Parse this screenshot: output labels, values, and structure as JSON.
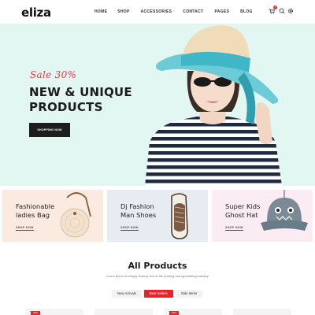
{
  "header": {
    "logo": "eliza",
    "nav": [
      "HOME",
      "SHOP",
      "ACCESSORIES",
      "CONTACT",
      "PAGES",
      "BLOG"
    ],
    "cart_count": "0",
    "icons": [
      "cart-icon",
      "search-icon",
      "settings-icon"
    ]
  },
  "hero": {
    "sale_text": "Sale 30%",
    "title_line1": "NEW & UNIQUE",
    "title_line2": "PRODUCTS",
    "button_label": "SHOPPING NOW"
  },
  "categories": [
    {
      "title": "Fashionable\nladies Bag",
      "link": "SHOP NOW",
      "bg": "#fbeadf"
    },
    {
      "title": "Dj Fashion\nMan Shoes",
      "link": "SHOP NOW",
      "bg": "#e6ecf1"
    },
    {
      "title": "Super Kids\nGhost Hat",
      "link": "SHOP NOW",
      "bg": "#fbebf3"
    }
  ],
  "products": {
    "title": "All Products",
    "subtitle": "Lorem Ipsum is simply dummy text of the printing and typesetting industry.",
    "tabs": [
      {
        "label": "New Arrivals",
        "active": false
      },
      {
        "label": "Best Sellers",
        "active": true
      },
      {
        "label": "Sale Items",
        "active": false
      }
    ],
    "badge": "30%"
  },
  "colors": {
    "accent": "#e0262c",
    "hero_bg": "#e2f6f2"
  }
}
